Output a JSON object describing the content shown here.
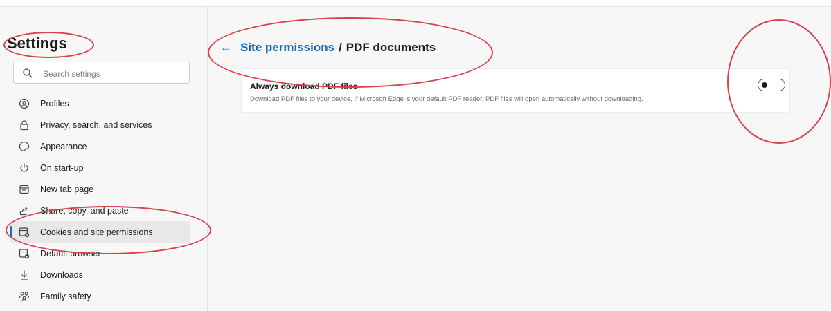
{
  "sidebar": {
    "title": "Settings",
    "search": {
      "placeholder": "Search settings",
      "value": ""
    },
    "items": [
      {
        "label": "Profiles",
        "icon": "profile-icon"
      },
      {
        "label": "Privacy, search, and services",
        "icon": "lock-icon"
      },
      {
        "label": "Appearance",
        "icon": "palette-icon"
      },
      {
        "label": "On start-up",
        "icon": "power-icon"
      },
      {
        "label": "New tab page",
        "icon": "new-tab-icon"
      },
      {
        "label": "Share, copy, and paste",
        "icon": "share-icon"
      },
      {
        "label": "Cookies and site permissions",
        "icon": "cookies-icon",
        "active": true
      },
      {
        "label": "Default browser",
        "icon": "default-browser-icon"
      },
      {
        "label": "Downloads",
        "icon": "download-icon"
      },
      {
        "label": "Family safety",
        "icon": "family-icon"
      }
    ]
  },
  "main": {
    "breadcrumb": {
      "parent": "Site permissions",
      "separator": "/",
      "current": "PDF documents"
    },
    "setting": {
      "title": "Always download PDF files",
      "description": "Download PDF files to your device. If Microsoft Edge is your default PDF reader, PDF files will open automatically without downloading.",
      "enabled": false
    }
  },
  "colors": {
    "accent": "#0f6cbd",
    "annotation": "#d9404a",
    "background": "#f7f7f7"
  }
}
